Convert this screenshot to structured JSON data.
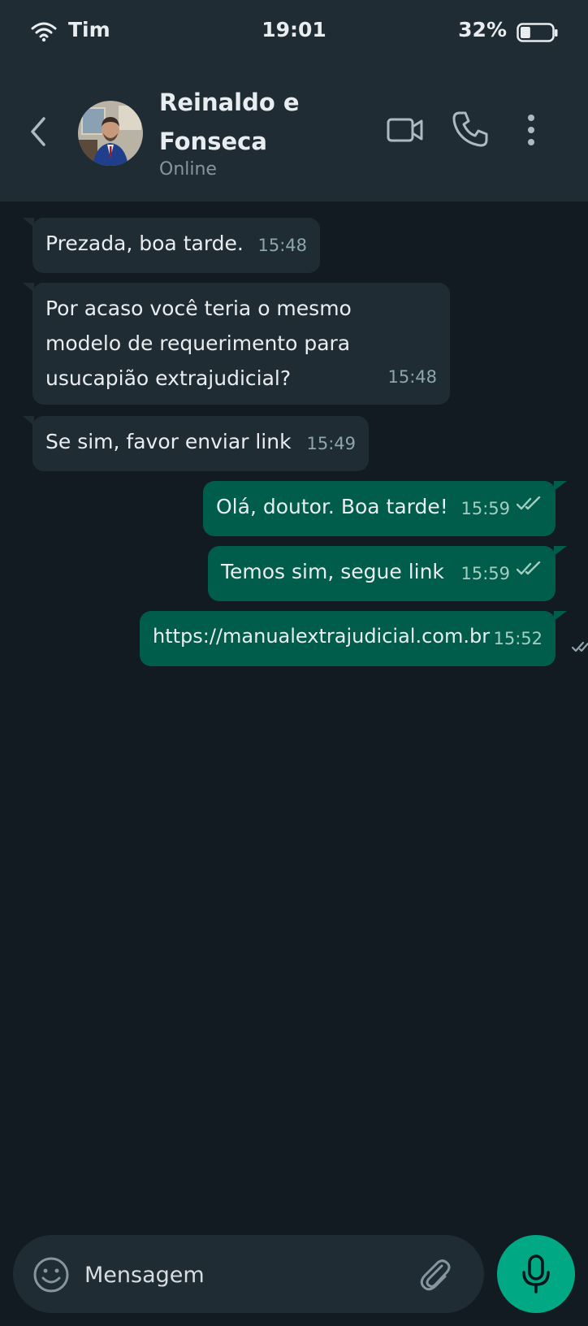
{
  "status_bar": {
    "carrier": "Tim",
    "time": "19:01",
    "battery": "32%",
    "battery_level": 0.32
  },
  "header": {
    "contact_name": "Reinaldo e Fonseca",
    "contact_status": "Online"
  },
  "messages": [
    {
      "direction": "incoming",
      "text": "Prezada, boa tarde.",
      "time": "15:48"
    },
    {
      "direction": "incoming",
      "text": "Por acaso você teria o mesmo\nmodelo de requerimento para\nusucapião extrajudicial?",
      "time": "15:48"
    },
    {
      "direction": "incoming",
      "text": "Se sim, favor enviar link",
      "time": "15:49"
    },
    {
      "direction": "outgoing",
      "text": "Olá, doutor. Boa tarde!",
      "time": "15:59",
      "status": "read"
    },
    {
      "direction": "outgoing",
      "text": "Temos sim, segue link",
      "time": "15:59",
      "status": "read"
    },
    {
      "direction": "outgoing",
      "text": "https://manualextrajudicial.com.br",
      "time": "15:52",
      "status": "read"
    }
  ],
  "composer": {
    "placeholder": "Mensagem"
  },
  "colors": {
    "background": "#121b22",
    "header": "#1f2c34",
    "incoming_bubble": "#202c33",
    "outgoing_bubble": "#005c4b",
    "accent": "#00a884"
  },
  "icons": {
    "wifi": "wifi-icon",
    "battery": "battery-icon",
    "back": "chevron-left-icon",
    "video": "video-camera-icon",
    "phone": "phone-icon",
    "menu": "more-vertical-icon",
    "emoji": "emoji-icon",
    "attach": "paperclip-icon",
    "mic": "microphone-icon"
  }
}
